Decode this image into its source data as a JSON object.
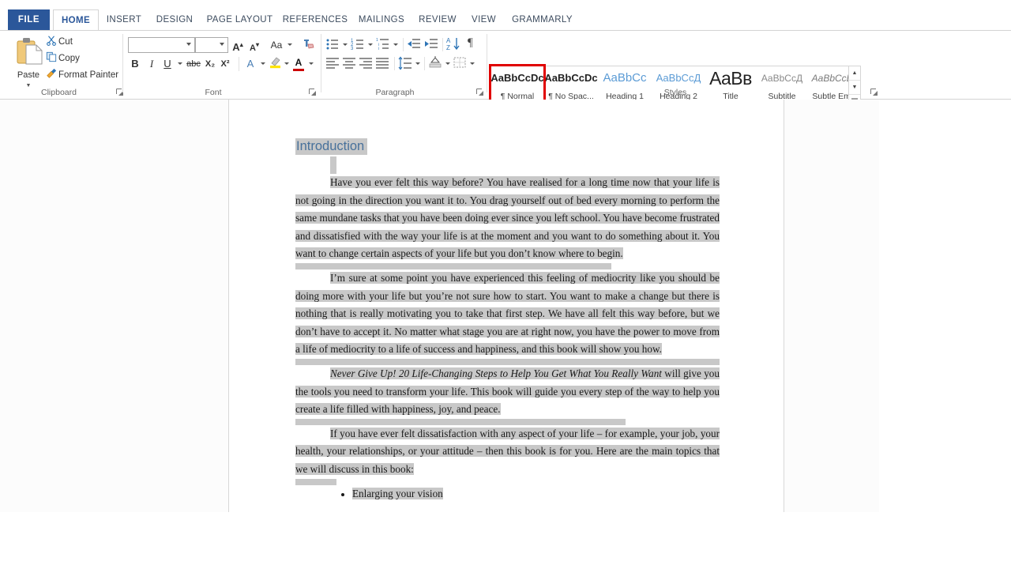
{
  "window": {
    "app": "Microsoft Word",
    "watermark_icon": "circuit-logo-watermark"
  },
  "ribbon_tabs": [
    {
      "label": "FILE",
      "state": "file"
    },
    {
      "label": "HOME",
      "state": "active"
    },
    {
      "label": "INSERT",
      "state": "normal"
    },
    {
      "label": "DESIGN",
      "state": "normal"
    },
    {
      "label": "PAGE LAYOUT",
      "state": "normal"
    },
    {
      "label": "REFERENCES",
      "state": "normal"
    },
    {
      "label": "MAILINGS",
      "state": "normal"
    },
    {
      "label": "REVIEW",
      "state": "normal"
    },
    {
      "label": "VIEW",
      "state": "normal"
    },
    {
      "label": "GRAMMARLY",
      "state": "normal"
    }
  ],
  "groups": {
    "clipboard": {
      "label": "Clipboard",
      "paste_label": "Paste",
      "cut_label": "Cut",
      "copy_label": "Copy",
      "format_painter_label": "Format Painter",
      "dialog_launcher": "clipboard-dialog-launcher"
    },
    "font": {
      "label": "Font",
      "font_name_value": "",
      "font_name_placeholder": "",
      "font_size_value": "",
      "font_size_placeholder": "",
      "grow_font": "A",
      "shrink_font": "A",
      "change_case": "Aa",
      "clear_formatting": "clear-formatting-icon",
      "bold": "B",
      "italic": "I",
      "underline": "U",
      "strikethrough": "abc",
      "subscript": "X₂",
      "superscript": "X²",
      "text_effects": "A",
      "text_highlight": "highlight-icon",
      "font_color": "A",
      "dialog_launcher": "font-dialog-launcher"
    },
    "paragraph": {
      "label": "Paragraph",
      "bullets": "bullets-icon",
      "numbering": "numbering-icon",
      "multilevel_list": "multilevel-list-icon",
      "decrease_indent": "decrease-indent-icon",
      "increase_indent": "increase-indent-icon",
      "sort": "sort-icon",
      "show_marks": "¶",
      "align_left": "align-left-icon",
      "align_center": "align-center-icon",
      "align_right": "align-right-icon",
      "justify": "justify-icon",
      "line_spacing": "line-spacing-icon",
      "shading": "shading-icon",
      "borders": "borders-icon",
      "dialog_launcher": "paragraph-dialog-launcher"
    },
    "styles": {
      "label": "Styles",
      "dialog_launcher": "styles-dialog-launcher",
      "scroll_up": "▲",
      "scroll_down": "▼",
      "more": "more-styles-icon",
      "highlight_color": "#e00000",
      "items": [
        {
          "preview": "AaBbCcDc",
          "name": "¶ Normal",
          "selected": true
        },
        {
          "preview": "AaBbCcDc",
          "name": "¶ No Spac...",
          "selected": false
        },
        {
          "preview": "AaBbCс",
          "name": "Heading 1",
          "selected": false
        },
        {
          "preview": "AaBbCcД",
          "name": "Heading 2",
          "selected": false
        },
        {
          "preview": "AaBʙ",
          "name": "Title",
          "selected": false
        },
        {
          "preview": "AaBbCcД",
          "name": "Subtitle",
          "selected": false
        },
        {
          "preview": "AaBbCcDс",
          "name": "Subtle Em...",
          "selected": false
        }
      ]
    }
  },
  "document": {
    "heading": "Introduction",
    "paragraphs": [
      "Have you ever felt this way before? You have realised for a long time now that your life is not going in the direction you want it to. You drag yourself out of bed every morning to perform the same mundane tasks that you have been doing ever since you left school. You have become frustrated and dissatisfied with the way your life is at the moment and you want to do something about it. You want to change certain aspects of your life but you don’t know where to begin.",
      "I’m sure at some point you have experienced this feeling of mediocrity like you should be doing more with your life but you’re not sure how to start. You want to make a change but there is nothing that is really motivating you to take that first step. We have all felt this way before, but we don’t have to accept it. No matter what stage you are at right now, you have the power to move from a life of mediocrity to a life of success and happiness, and this book will show you how."
    ],
    "book_title_paragraph": {
      "title_italic": "Never Give Up! 20 Life-Changing Steps to Help You Get What You Really Want",
      "rest": " will give you the tools you need to transform your life. This book will guide you every step of the way to help you create a life filled with happiness, joy, and peace."
    },
    "closing_paragraph": "If you have ever felt dissatisfaction with any aspect of your life – for example, your job, your health, your relationships, or your attitude – then this book is for you. Here are the main topics that we will discuss in this book:",
    "bullets": [
      "Enlarging your vision"
    ],
    "selection_color": "#c8c8c8",
    "heading_color": "#48719b"
  }
}
